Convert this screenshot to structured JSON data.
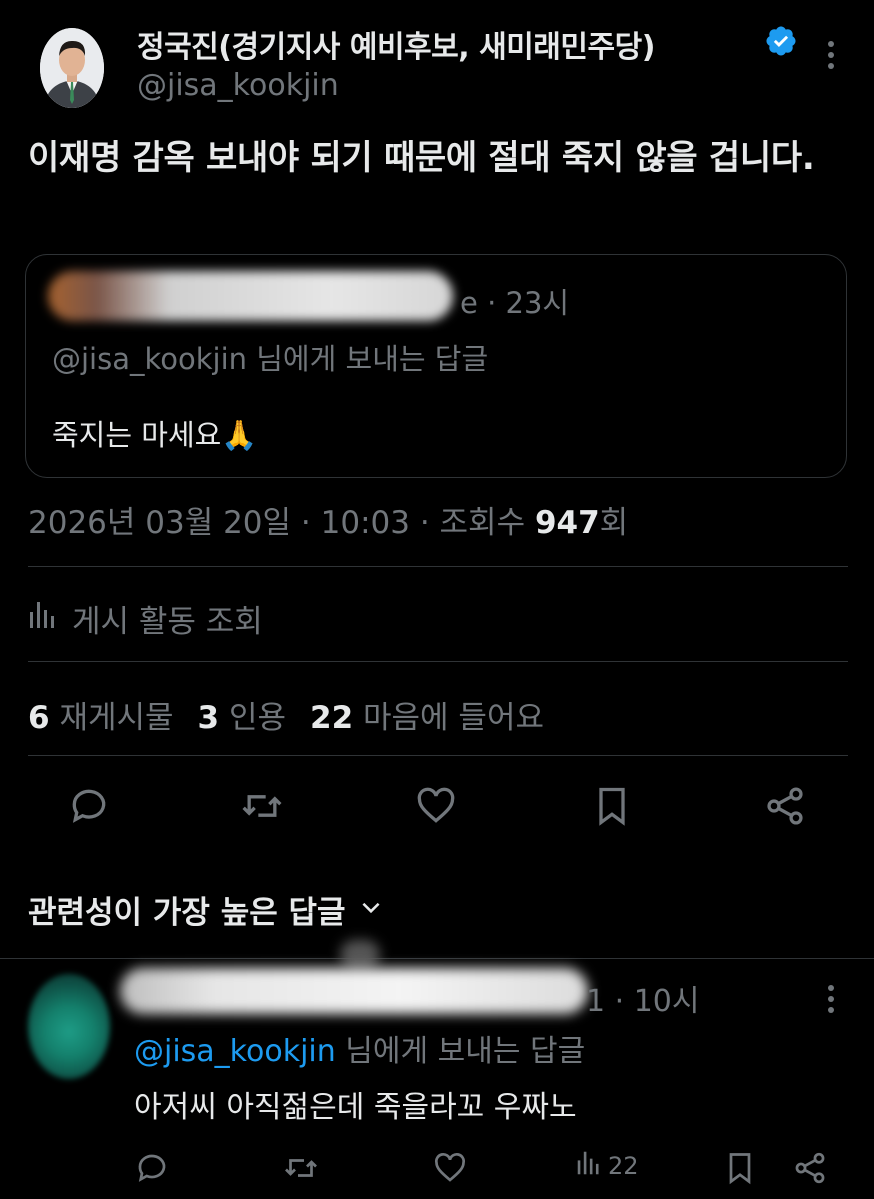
{
  "author": {
    "name": "정국진(경기지사 예비후보, 새미래민주당)",
    "handle": "@jisa_kookjin",
    "verified_color": "#1d9bf0"
  },
  "tweet": {
    "text": "이재명 감옥 보내야 되기 때문에 절대 죽지 않을 겁니다."
  },
  "quote": {
    "name_suffix": "e",
    "time": "· 23시",
    "reply_handle": "@jisa_kookjin",
    "reply_suffix": " 님에게 보내는 답글",
    "text": "죽지는 마세요🙏"
  },
  "meta": {
    "date": "2026년 03월 20일",
    "time": "10:03",
    "views_label": "조회수",
    "views_count": "947",
    "views_unit": "회"
  },
  "activity": {
    "label": "게시 활동 조회",
    "icon": "bar-chart-icon"
  },
  "stats": {
    "retweets_count": "6",
    "retweets_label": "재게시물",
    "quotes_count": "3",
    "quotes_label": "인용",
    "likes_count": "22",
    "likes_label": "마음에 들어요"
  },
  "sort": {
    "label": "관련성이 가장 높은 답글",
    "icon": "chevron-down-icon"
  },
  "reply": {
    "name_suffix": "1",
    "time": "· 10시",
    "reply_handle": "@jisa_kookjin",
    "reply_suffix": " 님에게 보내는 답글",
    "text": "아저씨 아직젊은데 죽을라꼬 우짜노",
    "views": "22"
  },
  "colors": {
    "background": "#000000",
    "text": "#e7e9ea",
    "secondary": "#71767b",
    "accent": "#1d9bf0",
    "border": "#2f3336"
  }
}
